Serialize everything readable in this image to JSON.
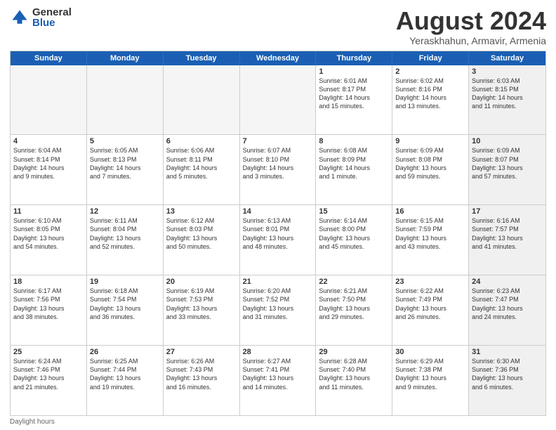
{
  "logo": {
    "general": "General",
    "blue": "Blue"
  },
  "header": {
    "month": "August 2024",
    "location": "Yeraskhahun, Armavir, Armenia"
  },
  "days": [
    "Sunday",
    "Monday",
    "Tuesday",
    "Wednesday",
    "Thursday",
    "Friday",
    "Saturday"
  ],
  "rows": [
    [
      {
        "day": "",
        "empty": true
      },
      {
        "day": "",
        "empty": true
      },
      {
        "day": "",
        "empty": true
      },
      {
        "day": "",
        "empty": true
      },
      {
        "day": "1",
        "lines": [
          "Sunrise: 6:01 AM",
          "Sunset: 8:17 PM",
          "Daylight: 14 hours",
          "and 15 minutes."
        ]
      },
      {
        "day": "2",
        "lines": [
          "Sunrise: 6:02 AM",
          "Sunset: 8:16 PM",
          "Daylight: 14 hours",
          "and 13 minutes."
        ]
      },
      {
        "day": "3",
        "lines": [
          "Sunrise: 6:03 AM",
          "Sunset: 8:15 PM",
          "Daylight: 14 hours",
          "and 11 minutes."
        ],
        "shaded": true
      }
    ],
    [
      {
        "day": "4",
        "lines": [
          "Sunrise: 6:04 AM",
          "Sunset: 8:14 PM",
          "Daylight: 14 hours",
          "and 9 minutes."
        ]
      },
      {
        "day": "5",
        "lines": [
          "Sunrise: 6:05 AM",
          "Sunset: 8:13 PM",
          "Daylight: 14 hours",
          "and 7 minutes."
        ]
      },
      {
        "day": "6",
        "lines": [
          "Sunrise: 6:06 AM",
          "Sunset: 8:11 PM",
          "Daylight: 14 hours",
          "and 5 minutes."
        ]
      },
      {
        "day": "7",
        "lines": [
          "Sunrise: 6:07 AM",
          "Sunset: 8:10 PM",
          "Daylight: 14 hours",
          "and 3 minutes."
        ]
      },
      {
        "day": "8",
        "lines": [
          "Sunrise: 6:08 AM",
          "Sunset: 8:09 PM",
          "Daylight: 14 hours",
          "and 1 minute."
        ]
      },
      {
        "day": "9",
        "lines": [
          "Sunrise: 6:09 AM",
          "Sunset: 8:08 PM",
          "Daylight: 13 hours",
          "and 59 minutes."
        ]
      },
      {
        "day": "10",
        "lines": [
          "Sunrise: 6:09 AM",
          "Sunset: 8:07 PM",
          "Daylight: 13 hours",
          "and 57 minutes."
        ],
        "shaded": true
      }
    ],
    [
      {
        "day": "11",
        "lines": [
          "Sunrise: 6:10 AM",
          "Sunset: 8:05 PM",
          "Daylight: 13 hours",
          "and 54 minutes."
        ]
      },
      {
        "day": "12",
        "lines": [
          "Sunrise: 6:11 AM",
          "Sunset: 8:04 PM",
          "Daylight: 13 hours",
          "and 52 minutes."
        ]
      },
      {
        "day": "13",
        "lines": [
          "Sunrise: 6:12 AM",
          "Sunset: 8:03 PM",
          "Daylight: 13 hours",
          "and 50 minutes."
        ]
      },
      {
        "day": "14",
        "lines": [
          "Sunrise: 6:13 AM",
          "Sunset: 8:01 PM",
          "Daylight: 13 hours",
          "and 48 minutes."
        ]
      },
      {
        "day": "15",
        "lines": [
          "Sunrise: 6:14 AM",
          "Sunset: 8:00 PM",
          "Daylight: 13 hours",
          "and 45 minutes."
        ]
      },
      {
        "day": "16",
        "lines": [
          "Sunrise: 6:15 AM",
          "Sunset: 7:59 PM",
          "Daylight: 13 hours",
          "and 43 minutes."
        ]
      },
      {
        "day": "17",
        "lines": [
          "Sunrise: 6:16 AM",
          "Sunset: 7:57 PM",
          "Daylight: 13 hours",
          "and 41 minutes."
        ],
        "shaded": true
      }
    ],
    [
      {
        "day": "18",
        "lines": [
          "Sunrise: 6:17 AM",
          "Sunset: 7:56 PM",
          "Daylight: 13 hours",
          "and 38 minutes."
        ]
      },
      {
        "day": "19",
        "lines": [
          "Sunrise: 6:18 AM",
          "Sunset: 7:54 PM",
          "Daylight: 13 hours",
          "and 36 minutes."
        ]
      },
      {
        "day": "20",
        "lines": [
          "Sunrise: 6:19 AM",
          "Sunset: 7:53 PM",
          "Daylight: 13 hours",
          "and 33 minutes."
        ]
      },
      {
        "day": "21",
        "lines": [
          "Sunrise: 6:20 AM",
          "Sunset: 7:52 PM",
          "Daylight: 13 hours",
          "and 31 minutes."
        ]
      },
      {
        "day": "22",
        "lines": [
          "Sunrise: 6:21 AM",
          "Sunset: 7:50 PM",
          "Daylight: 13 hours",
          "and 29 minutes."
        ]
      },
      {
        "day": "23",
        "lines": [
          "Sunrise: 6:22 AM",
          "Sunset: 7:49 PM",
          "Daylight: 13 hours",
          "and 26 minutes."
        ]
      },
      {
        "day": "24",
        "lines": [
          "Sunrise: 6:23 AM",
          "Sunset: 7:47 PM",
          "Daylight: 13 hours",
          "and 24 minutes."
        ],
        "shaded": true
      }
    ],
    [
      {
        "day": "25",
        "lines": [
          "Sunrise: 6:24 AM",
          "Sunset: 7:46 PM",
          "Daylight: 13 hours",
          "and 21 minutes."
        ]
      },
      {
        "day": "26",
        "lines": [
          "Sunrise: 6:25 AM",
          "Sunset: 7:44 PM",
          "Daylight: 13 hours",
          "and 19 minutes."
        ]
      },
      {
        "day": "27",
        "lines": [
          "Sunrise: 6:26 AM",
          "Sunset: 7:43 PM",
          "Daylight: 13 hours",
          "and 16 minutes."
        ]
      },
      {
        "day": "28",
        "lines": [
          "Sunrise: 6:27 AM",
          "Sunset: 7:41 PM",
          "Daylight: 13 hours",
          "and 14 minutes."
        ]
      },
      {
        "day": "29",
        "lines": [
          "Sunrise: 6:28 AM",
          "Sunset: 7:40 PM",
          "Daylight: 13 hours",
          "and 11 minutes."
        ]
      },
      {
        "day": "30",
        "lines": [
          "Sunrise: 6:29 AM",
          "Sunset: 7:38 PM",
          "Daylight: 13 hours",
          "and 9 minutes."
        ]
      },
      {
        "day": "31",
        "lines": [
          "Sunrise: 6:30 AM",
          "Sunset: 7:36 PM",
          "Daylight: 13 hours",
          "and 6 minutes."
        ],
        "shaded": true
      }
    ]
  ],
  "footer": "Daylight hours"
}
